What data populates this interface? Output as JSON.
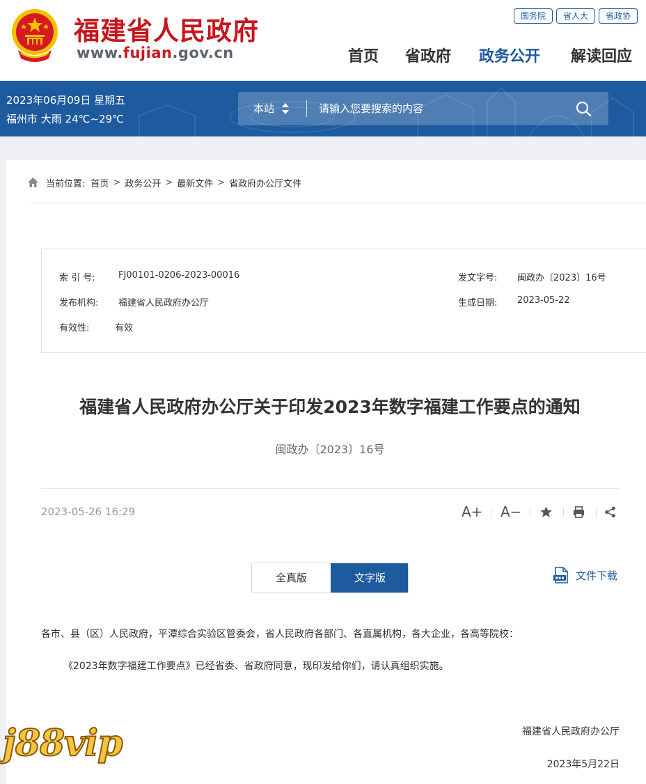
{
  "header": {
    "site_title": "福建省人民政府",
    "url_prefix": "www.",
    "url_highlight": "fujian",
    "url_suffix": ".gov.cn",
    "top_links": [
      "国务院",
      "省人大",
      "省政协"
    ],
    "nav": [
      "首页",
      "省政府",
      "政务公开",
      "解读回应"
    ],
    "active_nav": "政务公开"
  },
  "banner": {
    "date": "2023年06月09日 星期五",
    "weather": "福州市 大雨 24℃~29℃",
    "search_scope": "本站",
    "search_placeholder": "请输入您要搜索的内容"
  },
  "breadcrumb": {
    "prefix": "当前位置:",
    "items": [
      "首页",
      "政务公开",
      "最新文件",
      "省政府办公厅文件"
    ],
    "separator": ">"
  },
  "meta": {
    "index_label": "索 引 号:",
    "index_value": "FJ00101-0206-2023-00016",
    "doc_no_label": "发文字号:",
    "doc_no_value": "闽政办〔2023〕16号",
    "issuer_label": "发布机构:",
    "issuer_value": "福建省人民政府办公厅",
    "date_label": "生成日期:",
    "date_value": "2023-05-22",
    "validity_label": "有效性:",
    "validity_value": "有效"
  },
  "document": {
    "title": "福建省人民政府办公厅关于印发2023年数字福建工作要点的通知",
    "number": "闽政办〔2023〕16号",
    "published": "2023-05-26 16:29",
    "tools": {
      "font_up": "A+",
      "font_down": "A−"
    },
    "tabs": [
      "全真版",
      "文字版"
    ],
    "active_tab": "文字版",
    "download_label": "文件下载",
    "salutation": "各市、县（区）人民政府，平潭综合实验区管委会，省人民政府各部门、各直属机构，各大企业，各高等院校：",
    "paragraph": "《2023年数字福建工作要点》已经省委、省政府同意，现印发给你们，请认真组织实施。",
    "signature": "福建省人民政府办公厅",
    "sign_date": "2023年5月22日"
  },
  "watermark": "j88vip",
  "colors": {
    "brand_red": "#c8161d",
    "brand_blue": "#1d5a9e",
    "page_bg": "#eef0f3"
  },
  "icons": [
    "national-emblem",
    "sort-arrows-icon",
    "search-icon",
    "home-icon",
    "star-icon",
    "print-icon",
    "share-icon",
    "ofd-file-icon"
  ]
}
